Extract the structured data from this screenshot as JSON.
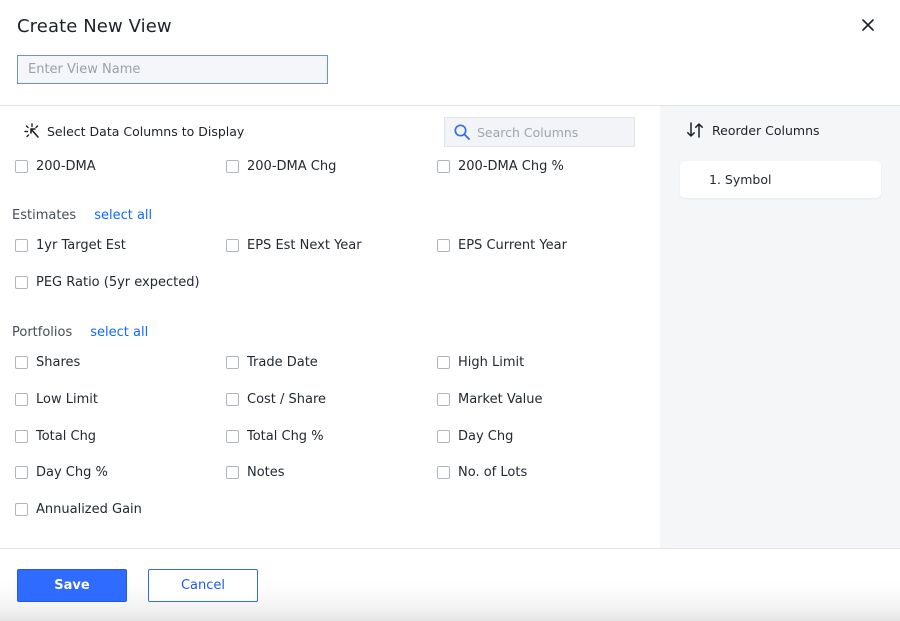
{
  "header": {
    "title": "Create New View",
    "close_icon": "close-icon",
    "view_name": {
      "value": "",
      "placeholder": "Enter View Name"
    }
  },
  "columns_panel": {
    "heading": "Select Data Columns to Display",
    "heading_icon": "magic-wand-icon",
    "search": {
      "placeholder": "Search Columns",
      "value": "",
      "icon": "search-icon"
    },
    "top_options": [
      {
        "label": "200-DMA",
        "checked": false
      },
      {
        "label": "200-DMA Chg",
        "checked": false
      },
      {
        "label": "200-DMA Chg %",
        "checked": false
      }
    ],
    "sections": [
      {
        "title": "Estimates",
        "select_all_label": "select all",
        "options": [
          {
            "label": "1yr Target Est",
            "checked": false
          },
          {
            "label": "EPS Est Next Year",
            "checked": false
          },
          {
            "label": "EPS Current Year",
            "checked": false
          },
          {
            "label": "PEG Ratio (5yr expected)",
            "checked": false
          }
        ]
      },
      {
        "title": "Portfolios",
        "select_all_label": "select all",
        "options": [
          {
            "label": "Shares",
            "checked": false
          },
          {
            "label": "Trade Date",
            "checked": false
          },
          {
            "label": "High Limit",
            "checked": false
          },
          {
            "label": "Low Limit",
            "checked": false
          },
          {
            "label": "Cost / Share",
            "checked": false
          },
          {
            "label": "Market Value",
            "checked": false
          },
          {
            "label": "Total Chg",
            "checked": false
          },
          {
            "label": "Total Chg %",
            "checked": false
          },
          {
            "label": "Day Chg",
            "checked": false
          },
          {
            "label": "Day Chg %",
            "checked": false
          },
          {
            "label": "Notes",
            "checked": false
          },
          {
            "label": "No. of Lots",
            "checked": false
          },
          {
            "label": "Annualized Gain",
            "checked": false
          }
        ]
      }
    ]
  },
  "reorder_panel": {
    "heading": "Reorder Columns",
    "heading_icon": "sort-arrows-icon",
    "items": [
      "1. Symbol"
    ]
  },
  "footer": {
    "save_label": "Save",
    "cancel_label": "Cancel"
  },
  "colors": {
    "accent": "#2f6bff",
    "link": "#0f69ff",
    "panel_bg": "#f5f6f8"
  }
}
